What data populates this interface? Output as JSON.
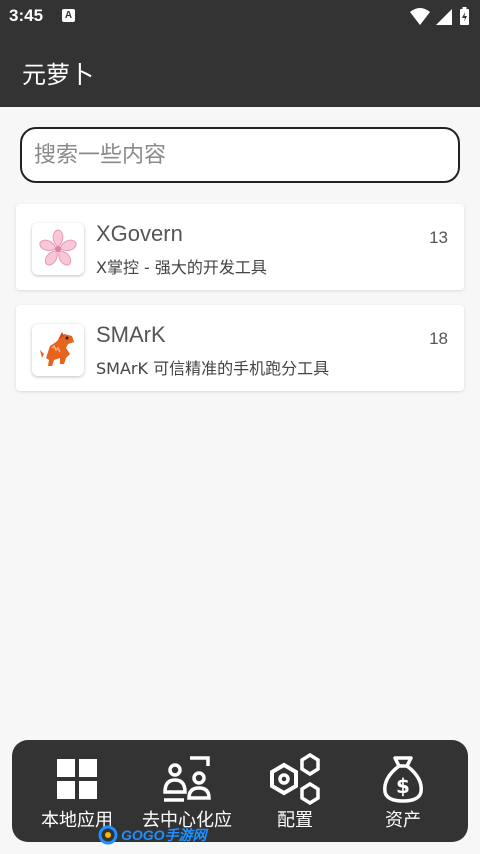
{
  "status_bar": {
    "time": "3:45",
    "notification_badge": "A",
    "icons": [
      "wifi-icon",
      "signal-icon",
      "battery-icon"
    ]
  },
  "app_bar": {
    "title": "元萝卜"
  },
  "search": {
    "placeholder": "搜索一些内容",
    "value": ""
  },
  "apps": [
    {
      "name": "XGovern",
      "description": "X掌控 - 强大的开发工具",
      "count": "13",
      "icon": "sakura-icon"
    },
    {
      "name": "SMArK",
      "description": "SMArK 可信精准的手机跑分工具",
      "count": "18",
      "icon": "dinosaur-icon"
    }
  ],
  "bottom_nav": {
    "items": [
      {
        "label": "本地应用",
        "icon": "grid-icon"
      },
      {
        "label": "去中心化应",
        "icon": "decentralized-scan-icon"
      },
      {
        "label": "配置",
        "icon": "hex-nut-icon"
      },
      {
        "label": "资产",
        "icon": "money-bag-icon"
      }
    ]
  },
  "watermark": {
    "text": "GOGO手游网"
  },
  "colors": {
    "app_bar_bg": "#333333",
    "page_bg": "#f7f7f7",
    "card_bg": "#ffffff",
    "nav_bg": "#333333"
  }
}
